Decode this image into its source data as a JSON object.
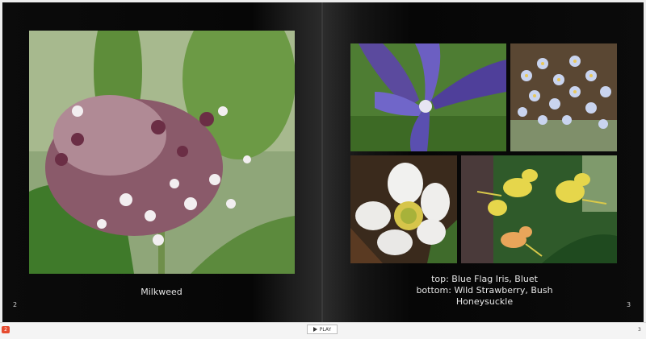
{
  "left_page": {
    "caption": "Milkweed",
    "page_number": "2"
  },
  "right_page": {
    "caption_line1": "top: Blue Flag Iris, Bluet",
    "caption_line2": "bottom: Wild Strawberry, Bush Honeysuckle",
    "page_number": "3"
  },
  "player": {
    "play_label": "PLAY",
    "current_page_badge": "2",
    "page_indicator": "3"
  },
  "icons": {
    "play": "play-icon"
  }
}
